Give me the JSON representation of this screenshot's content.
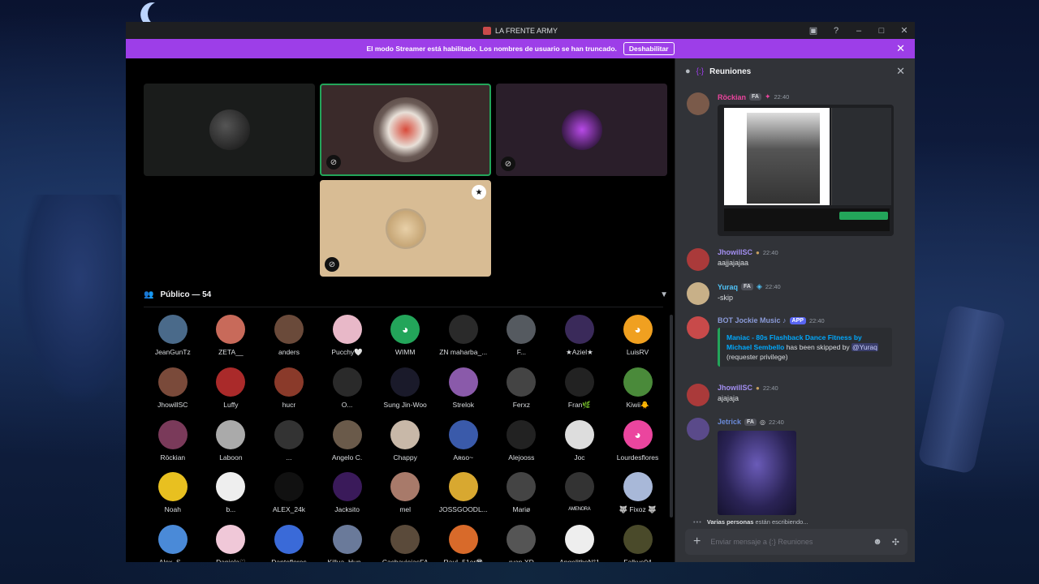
{
  "window": {
    "title": "LA FRENTE ARMY",
    "controls": {
      "inbox": "▣",
      "help": "?",
      "minimize": "–",
      "maximize": "□",
      "close": "✕"
    }
  },
  "streamer_bar": {
    "message": "El modo Streamer está habilitado. Los nombres de usuario se han truncado.",
    "button": "Deshabilitar",
    "close": "✕"
  },
  "stage": {
    "audience_header": "Público — 54",
    "audience": [
      {
        "name": "JeanGunTz",
        "color": "#4a6a8a"
      },
      {
        "name": "ZETA__",
        "color": "#c86a5a"
      },
      {
        "name": "anders",
        "color": "#6a4a3a"
      },
      {
        "name": "Pucchy🤍",
        "color": "#e8b8c8"
      },
      {
        "name": "WIMM",
        "color": "#23a55a",
        "glyph": "◕"
      },
      {
        "name": "ZN maharba_...",
        "color": "#2a2a2a"
      },
      {
        "name": "F...",
        "color": "#555a60"
      },
      {
        "name": "★Aziel★",
        "color": "#3a2a5a"
      },
      {
        "name": "LuisRV",
        "color": "#f0a020",
        "glyph": "◕"
      },
      {
        "name": "JhowillSC",
        "color": "#7a4a3a"
      },
      {
        "name": "Luffy",
        "color": "#aa2a2a"
      },
      {
        "name": "hucr",
        "color": "#8a3a2a"
      },
      {
        "name": "O...",
        "color": "#2a2a2a"
      },
      {
        "name": "Sung Jin-Woo",
        "color": "#1a1a2a"
      },
      {
        "name": "Strelok",
        "color": "#8a5aaa"
      },
      {
        "name": "Ferxz",
        "color": "#444"
      },
      {
        "name": "Fran🌿",
        "color": "#222"
      },
      {
        "name": "Kiwii🐥",
        "color": "#4a8a3a"
      },
      {
        "name": "Röckian",
        "color": "#7a3a5a"
      },
      {
        "name": "Laboon",
        "color": "#aaa"
      },
      {
        "name": "...",
        "color": "#333"
      },
      {
        "name": "Angelo C.",
        "color": "#6a5a4a"
      },
      {
        "name": "Chappy",
        "color": "#c8b8a8"
      },
      {
        "name": "Aʀɢᴏ~",
        "color": "#3a5aaa"
      },
      {
        "name": "Alejooss",
        "color": "#222"
      },
      {
        "name": "Joc",
        "color": "#ddd"
      },
      {
        "name": "Lourdesflores",
        "color": "#eb459e",
        "glyph": "◕"
      },
      {
        "name": "Noah",
        "color": "#e8c020"
      },
      {
        "name": "b...",
        "color": "#eee"
      },
      {
        "name": "ALEX_24k",
        "color": "#111"
      },
      {
        "name": "Jacksito",
        "color": "#3a1a5a"
      },
      {
        "name": "mel",
        "color": "#a87a6a"
      },
      {
        "name": "JOSSGOODL...",
        "color": "#d8a830"
      },
      {
        "name": "Mariø",
        "color": "#444"
      },
      {
        "name": "ᴬᴹᴱᴺᴼᴿᴬ",
        "color": "#333"
      },
      {
        "name": "🐺 Fixoz 🐺",
        "color": "#a8b8d8"
      },
      {
        "name": "Alex_S...",
        "color": "#4a8ad8"
      },
      {
        "name": "Daniela♡",
        "color": "#f0c8d8"
      },
      {
        "name": "Danteflores",
        "color": "#3a6ad8"
      },
      {
        "name": "Killua_Hun...",
        "color": "#6a7a9a"
      },
      {
        "name": "CachaviejasFA",
        "color": "#5a4a3a"
      },
      {
        "name": "Raul -51er😎",
        "color": "#d86a2a"
      },
      {
        "name": "ryan XD",
        "color": "#555"
      },
      {
        "name": "AngelithoN°1",
        "color": "#eee"
      },
      {
        "name": "Falkus04",
        "color": "#4a4a2a"
      }
    ]
  },
  "chat": {
    "channel": "Reuniones",
    "channel_icon": "{:}",
    "close": "✕",
    "messages": [
      {
        "user": "Röckian",
        "user_color": "#eb459e",
        "tag": "FA",
        "time": "22:40",
        "av": "#7a5a4a"
      },
      {
        "user": "JhowillSC",
        "user_color": "#a28ef0",
        "time": "22:40",
        "text": "aajjajajaa",
        "av": "#aa3a3a"
      },
      {
        "user": "Yuraq",
        "user_color": "#4fc3f7",
        "tag": "FA",
        "time": "22:40",
        "text": "-skip",
        "av": "#c8b088"
      },
      {
        "user": "BOT Jockie Music ♪",
        "user_color": "#8a9ad8",
        "tag": "APP",
        "time": "22:40",
        "av": "#c84a4a",
        "embed": {
          "song": "Maniac - 80s Flashback Dance Fitness by Michael Sembello",
          "middle": " has been skipped by ",
          "mention": "@Yuraq",
          "tail": " (requester privilege)"
        }
      },
      {
        "user": "JhowillSC",
        "user_color": "#a28ef0",
        "time": "22:40",
        "text": "ajajaja",
        "av": "#aa3a3a"
      },
      {
        "user": "Jetrick",
        "user_color": "#6a8ad8",
        "tag": "FA",
        "time": "22:40",
        "av": "#5a4a8a"
      }
    ],
    "typing_users": "Varias personas",
    "typing_text": "están escribiendo...",
    "placeholder": "Enviar mensaje a {:} Reuniones"
  }
}
